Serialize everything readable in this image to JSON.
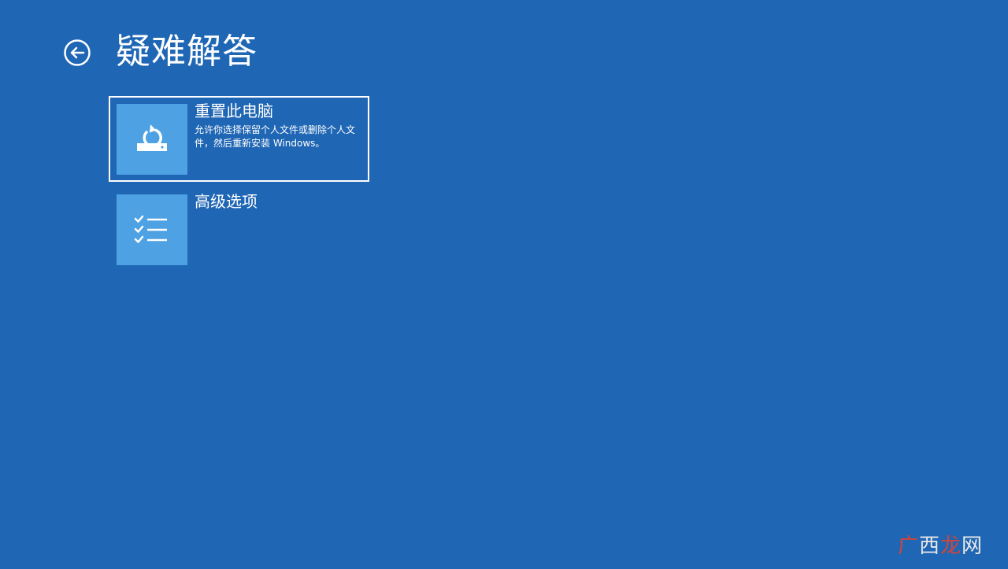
{
  "header": {
    "title": "疑难解答",
    "back_icon": "back-arrow-circle-icon"
  },
  "options": [
    {
      "title": "重置此电脑",
      "description": "允许你选择保留个人文件或删除个人文件，然后重新安装 Windows。",
      "icon": "reset-drive-icon",
      "selected": true
    },
    {
      "title": "高级选项",
      "description": "",
      "icon": "checklist-icon",
      "selected": false
    }
  ],
  "watermark": {
    "parts": [
      "广",
      "西",
      "龙",
      "网"
    ]
  },
  "colors": {
    "background": "#1f66b4",
    "tile": "#4ea1e3",
    "text": "#ffffff",
    "watermark_red": "#d2453a"
  }
}
